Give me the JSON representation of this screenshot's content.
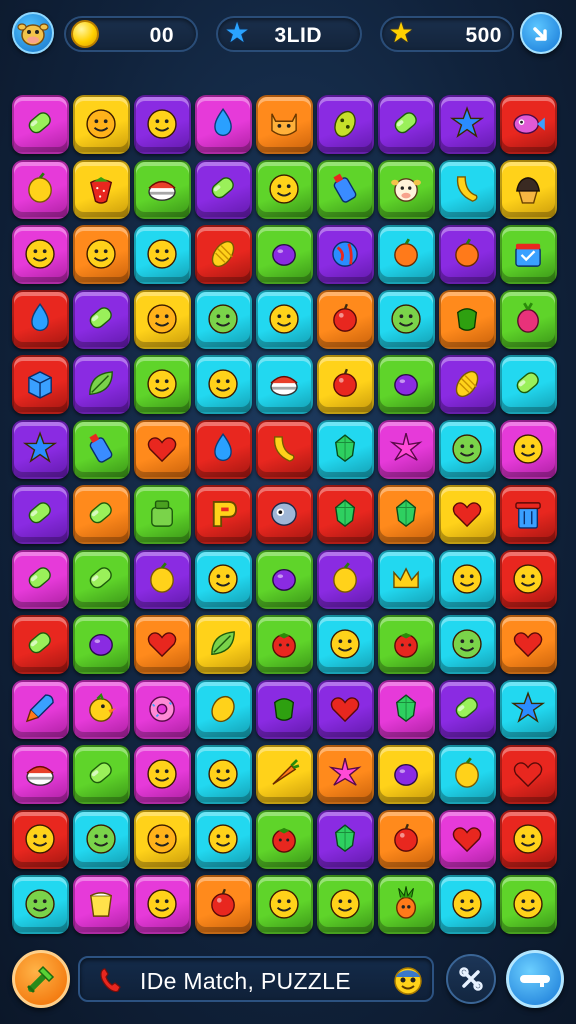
{
  "hud": {
    "avatar_icon": "cow-face-icon",
    "coins": {
      "icon": "coin-icon",
      "value": "00"
    },
    "stars": {
      "icon": "blue-star-icon",
      "value": "3LID"
    },
    "score": {
      "icon": "gold-star-icon",
      "value": "500"
    },
    "menu_button_icon": "down-arrow-icon"
  },
  "board": {
    "columns": 9,
    "rows": 13,
    "tiles": [
      [
        "magenta:candy",
        "yellow:smiley",
        "purple:smiley",
        "magenta:drop",
        "orange:cat",
        "purple:bean",
        "purple:candy",
        "purple:star",
        "red:fish"
      ],
      [
        "magenta:lemon",
        "yellow:strawberry",
        "green:sushi",
        "purple:candy",
        "green:smiley",
        "green:bottle",
        "green:cow",
        "cyan:banana",
        "yellow:cupcake"
      ],
      [
        "magenta:smiley",
        "orange:smiley",
        "cyan:smiley",
        "red:corn",
        "green:grape",
        "purple:globe",
        "cyan:orange",
        "purple:orange",
        "green:basket"
      ],
      [
        "red:drop",
        "purple:candy",
        "yellow:smiley",
        "cyan:smiley",
        "cyan:smiley",
        "orange:apple",
        "cyan:smiley",
        "orange:pepper",
        "green:radish"
      ],
      [
        "red:box",
        "purple:leaf",
        "green:smiley",
        "cyan:smiley",
        "cyan:sushi",
        "yellow:apple",
        "green:grape",
        "purple:corn",
        "cyan:candy"
      ],
      [
        "purple:star",
        "green:bottle",
        "orange:heart",
        "red:drop",
        "red:banana",
        "cyan:gem",
        "magenta:flower",
        "cyan:smiley",
        "magenta:smiley"
      ],
      [
        "purple:candy",
        "orange:candy",
        "green:jar",
        "red:p-letter",
        "red:eye",
        "red:gem",
        "orange:gem",
        "yellow:heart",
        "red:trashcan"
      ],
      [
        "magenta:candy",
        "green:candy",
        "purple:lemon",
        "cyan:smiley",
        "green:grape",
        "purple:lemon",
        "cyan:crown",
        "cyan:smiley",
        "red:smiley"
      ],
      [
        "red:candy",
        "green:grape",
        "orange:heart",
        "yellow:leaf",
        "green:tomato",
        "cyan:smiley",
        "green:tomato",
        "cyan:smiley",
        "orange:heart"
      ],
      [
        "magenta:rocket",
        "magenta:duck",
        "magenta:donut",
        "cyan:mango",
        "purple:pepper",
        "purple:heart",
        "magenta:gem",
        "purple:candy",
        "cyan:star"
      ],
      [
        "magenta:sushi",
        "green:candy",
        "magenta:smiley",
        "cyan:smiley",
        "yellow:carrot",
        "orange:flower",
        "yellow:grape",
        "cyan:lemon",
        "red:heart"
      ],
      [
        "red:smiley",
        "cyan:smiley",
        "yellow:smiley",
        "cyan:smiley",
        "green:tomato",
        "purple:gem",
        "orange:apple",
        "magenta:heart",
        "red:smiley"
      ],
      [
        "cyan:smiley",
        "magenta:cup",
        "magenta:smiley",
        "orange:apple",
        "green:smiley",
        "green:smiley",
        "green:pineapple",
        "cyan:smiley",
        "green:smiley"
      ]
    ]
  },
  "bottom": {
    "left_button_icon": "hammer-icon",
    "message_icon": "phone-icon",
    "message_text": "IDe Match, PUZZLE",
    "message_end_icon": "emoji-face-icon",
    "tool_button_icon": "tools-icon",
    "right_button_icon": "key-icon"
  },
  "colors": {
    "background": "#10223b",
    "magenta": "#e63ad9",
    "yellow": "#ffd21a",
    "purple": "#8a2be2",
    "orange": "#ff8a1c",
    "red": "#e8271f",
    "green": "#5fd42a",
    "cyan": "#22d8f0"
  }
}
